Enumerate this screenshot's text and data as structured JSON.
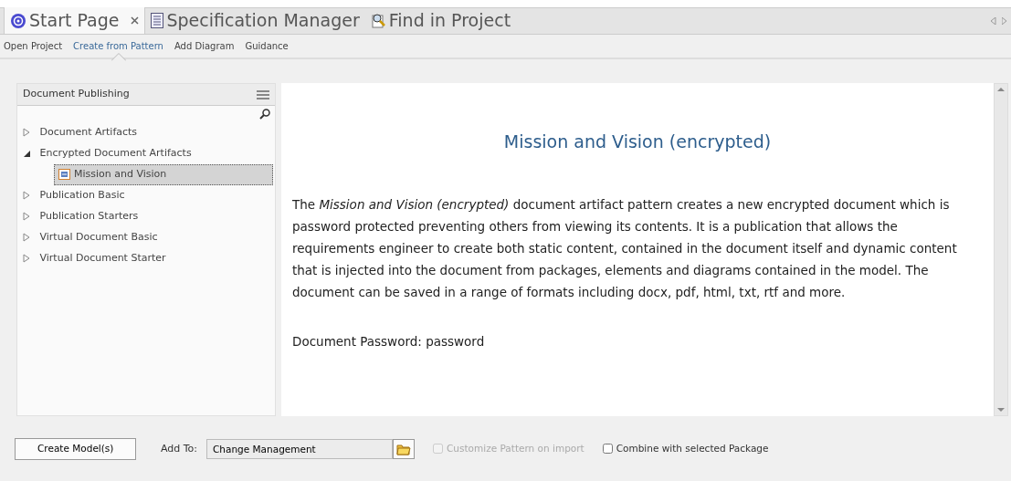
{
  "tabs": [
    {
      "label": "Start Page",
      "selected": true,
      "closable": true
    },
    {
      "label": "Specification Manager",
      "selected": false,
      "closable": false
    },
    {
      "label": "Find in Project",
      "selected": false,
      "closable": false
    }
  ],
  "subnav": [
    {
      "label": "Open Project",
      "selected": false
    },
    {
      "label": "Create from Pattern",
      "selected": true
    },
    {
      "label": "Add Diagram",
      "selected": false
    },
    {
      "label": "Guidance",
      "selected": false
    }
  ],
  "tree": {
    "title": "Document Publishing",
    "items": [
      {
        "label": "Document Artifacts",
        "expanded": false,
        "selected": false
      },
      {
        "label": "Encrypted Document Artifacts",
        "expanded": true,
        "selected": false,
        "children": [
          {
            "label": "Mission and Vision",
            "selected": true
          }
        ]
      },
      {
        "label": "Publication Basic",
        "expanded": false,
        "selected": false
      },
      {
        "label": "Publication Starters",
        "expanded": false,
        "selected": false
      },
      {
        "label": "Virtual Document Basic",
        "expanded": false,
        "selected": false
      },
      {
        "label": "Virtual Document Starter",
        "expanded": false,
        "selected": false
      }
    ]
  },
  "description": {
    "title": "Mission and Vision (encrypted)",
    "paragraphs": [
      "The *Mission and Vision (encrypted)* document artifact pattern creates a new encrypted document which is password protected preventing others from viewing its contents. It is a publication that allows the requirements engineer to create both static content, contained in the document itself and dynamic content that is injected into the document from packages, elements and diagrams contained in the model. The document can be saved in a range of formats including docx, pdf, html, txt, rtf and more.",
      "Document Password: password"
    ]
  },
  "footer": {
    "create_button": "Create Model(s)",
    "add_to_label": "Add To:",
    "add_to_value": "Change Management",
    "options": [
      {
        "label": "Customize Pattern on import",
        "checked": false,
        "disabled": true
      },
      {
        "label": "Combine with selected Package",
        "checked": false,
        "disabled": false
      }
    ]
  }
}
